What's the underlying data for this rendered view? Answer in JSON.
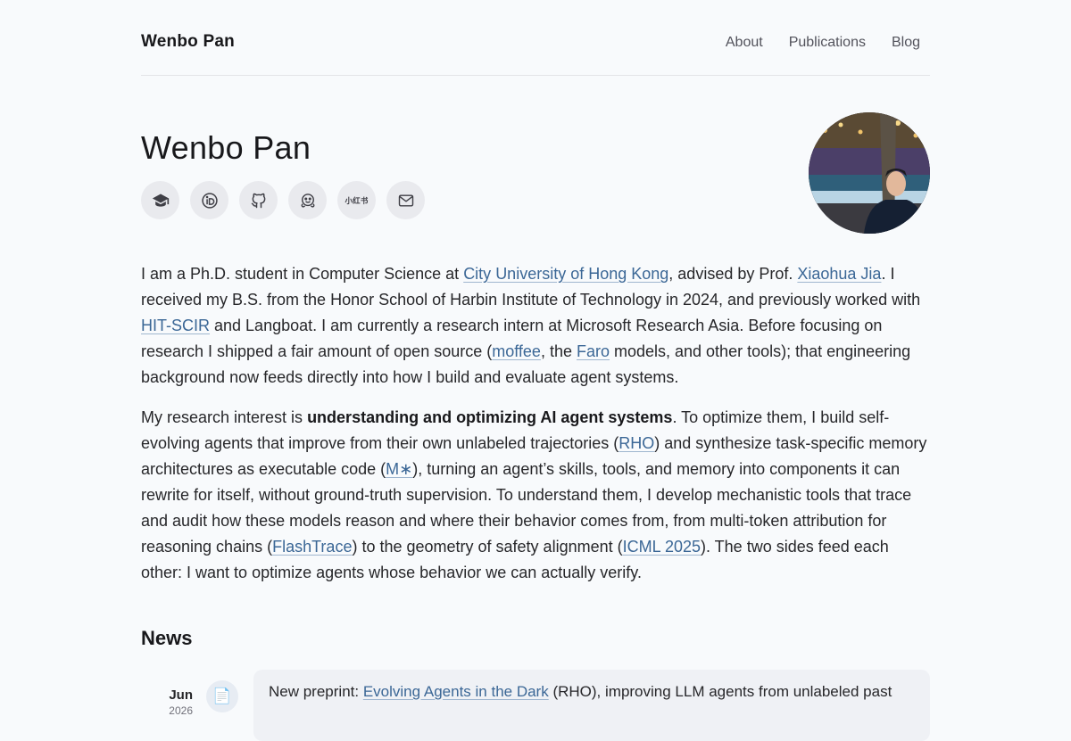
{
  "header": {
    "brand": "Wenbo Pan",
    "nav": [
      "About",
      "Publications",
      "Blog"
    ]
  },
  "hero": {
    "name": "Wenbo Pan",
    "social_icons": [
      "graduation-cap-icon",
      "orcid-icon",
      "github-icon",
      "huggingface-icon",
      "xiaohongshu-icon",
      "mail-icon"
    ],
    "xiaohongshu_label": "小红书"
  },
  "bio": {
    "p1": {
      "t1": "I am a Ph.D. student in Computer Science at ",
      "l1": "City University of Hong Kong",
      "t2": ", advised by Prof. ",
      "l2": "Xiaohua Jia",
      "t3": ". I received my B.S. from the Honor School of Harbin Institute of Technology in 2024, and previously worked with ",
      "l3": "HIT-SCIR",
      "t4": " and Langboat. I am currently a research intern at Microsoft Research Asia. Before focusing on research I shipped a fair amount of open source (",
      "l4": "moffee",
      "t5": ", the ",
      "l5": "Faro",
      "t6": " models, and other tools); that engineering background now feeds directly into how I build and evaluate agent systems."
    },
    "p2": {
      "t1": "My research interest is ",
      "b1": "understanding and optimizing AI agent systems",
      "t2": ". To optimize them, I build self-evolving agents that improve from their own unlabeled trajectories (",
      "l1": "RHO",
      "t3": ") and synthesize task-specific memory architectures as executable code (",
      "l2": "M∗",
      "t4": "), turning an agent’s skills, tools, and memory into components it can rewrite for itself, without ground-truth supervision. To understand them, I develop mechanistic tools that trace and audit how these models reason and where their behavior comes from, from multi-token attribution for reasoning chains (",
      "l3": "FlashTrace",
      "t5": ") to the geometry of safety alignment (",
      "l4": "ICML 2025",
      "t6": "). The two sides feed each other: I want to optimize agents whose behavior we can actually verify."
    }
  },
  "news": {
    "title": "News",
    "items": [
      {
        "month": "Jun",
        "year": "2026",
        "icon": "document-icon",
        "icon_glyph": "📄",
        "prefix": "New preprint: ",
        "link": "Evolving Agents in the Dark",
        "suffix": " (RHO), improving LLM agents from unlabeled past"
      }
    ]
  },
  "colors": {
    "background": "#f8fafc",
    "link": "#3b6796",
    "text": "#27272a"
  }
}
